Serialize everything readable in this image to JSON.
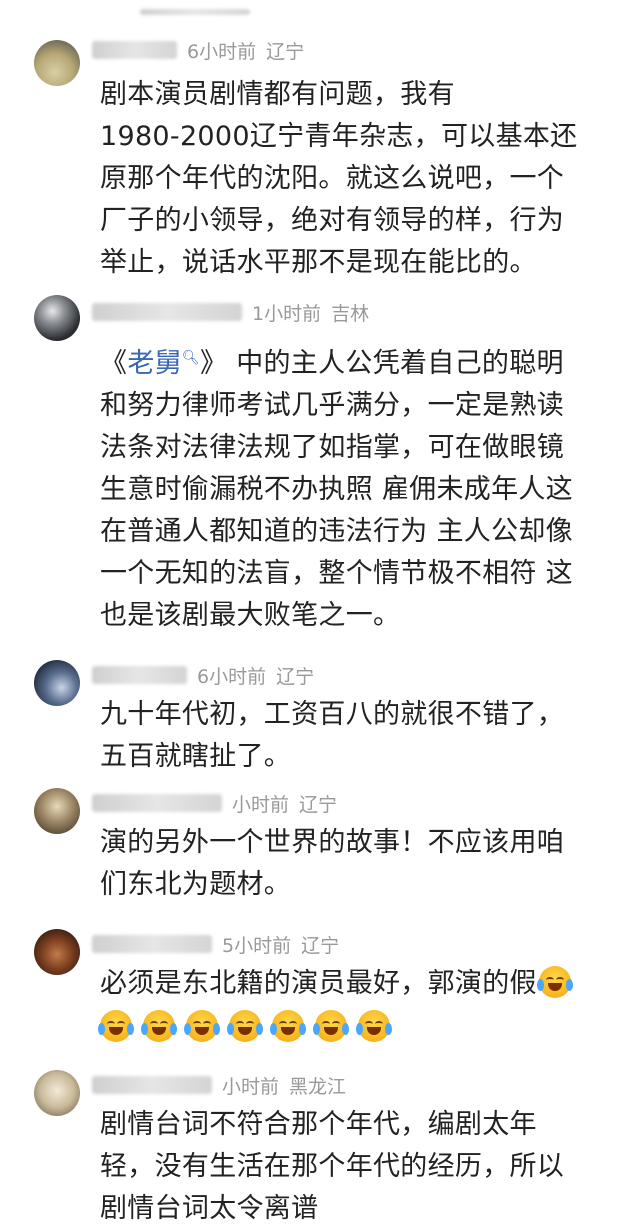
{
  "comments": [
    {
      "time": "6小时前",
      "region": "辽宁",
      "text": "剧本演员剧情都有问题，我有1980-2000辽宁青年杂志，可以基本还原那个年代的沈阳。就这么说吧，一个厂子的小领导，绝对有领导的样，行为举止，说话水平那不是现在能比的。",
      "lines": [
        "剧本演员剧情都有问题，我有",
        "1980-2000辽宁青年杂志，可以基本还",
        "原那个年代的沈阳。就这么说吧，一个",
        "厂子的小领导，绝对有领导的样，行为",
        "举止，说话水平那不是现在能比的。"
      ]
    },
    {
      "time": "1小时前",
      "region": "吉林",
      "link": "老舅",
      "search_icon": "search-icon",
      "lines": [
        "中的主人公凭着自己的聪明",
        "和努力律师考试几乎满分，一定是熟读",
        "法条对法律法规了如指掌，可在做眼镜",
        "生意时偷漏税不办执照 雇佣未成年人这",
        "在普通人都知道的违法行为 主人公却像",
        "一个无知的法盲，整个情节极不相符 这",
        "也是该剧最大败笔之一。"
      ],
      "open_quote": "《",
      "close_quote": "》"
    },
    {
      "time": "6小时前",
      "region": "辽宁",
      "lines": [
        "九十年代初，工资百八的就很不错了，",
        "五百就瞎扯了。"
      ]
    },
    {
      "time": "小时前",
      "region": "辽宁",
      "lines": [
        "演的另外一个世界的故事！不应该用咱",
        "们东北为题材。"
      ]
    },
    {
      "time": "5小时前",
      "region": "辽宁",
      "lines": [
        "必须是东北籍的演员最好，郭演的假"
      ],
      "emoji_name": "laughing-crying-emoji"
    },
    {
      "time": "小时前",
      "region": "黑龙江",
      "lines": [
        "剧情台词不符合那个年代，编剧太年",
        "轻，没有生活在那个年代的经历，所以",
        "剧情台词太令离谱"
      ]
    }
  ]
}
